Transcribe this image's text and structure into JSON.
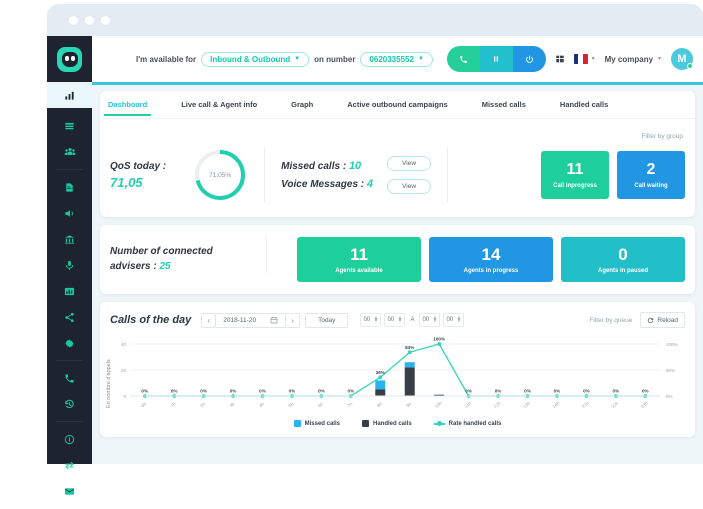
{
  "window": {
    "dots": 3
  },
  "header": {
    "available_prefix": "I'm available for",
    "availability": "Inbound & Outbound",
    "on_number_label": "on number",
    "number": "0620335552",
    "company": "My company",
    "avatar_initial": "M",
    "buttons": [
      {
        "name": "call-button",
        "icon": "phone-icon",
        "color": "#25cf9a"
      },
      {
        "name": "pause-button",
        "icon": "pause-icon",
        "color": "#24bfcc"
      },
      {
        "name": "power-button",
        "icon": "power-icon",
        "color": "#2196e3"
      }
    ],
    "apps_icon": "grid-icon",
    "language": "fr"
  },
  "sidebar": {
    "items": [
      {
        "name": "sidebar-item-dashboard",
        "icon": "bar-chart-icon",
        "active": true
      },
      {
        "name": "sidebar-item-tables",
        "icon": "table-icon",
        "active": false
      },
      {
        "name": "sidebar-item-groups",
        "icon": "users-icon",
        "active": false
      },
      {
        "name": "sidebar-item-documents",
        "icon": "document-icon",
        "active": false
      },
      {
        "name": "sidebar-item-announcements",
        "icon": "megaphone-icon",
        "active": false
      },
      {
        "name": "sidebar-item-company",
        "icon": "bank-icon",
        "active": false
      },
      {
        "name": "sidebar-item-recordings",
        "icon": "microphone-icon",
        "active": false
      },
      {
        "name": "sidebar-item-statistics",
        "icon": "chart-bars-icon",
        "active": false
      },
      {
        "name": "sidebar-item-routing",
        "icon": "share-nodes-icon",
        "active": false
      },
      {
        "name": "sidebar-item-settings",
        "icon": "gear-icon",
        "active": false
      },
      {
        "name": "sidebar-item-calls",
        "icon": "phone-icon",
        "active": false
      },
      {
        "name": "sidebar-item-history",
        "icon": "history-icon",
        "active": false
      },
      {
        "name": "sidebar-item-info",
        "icon": "info-icon",
        "active": false
      },
      {
        "name": "sidebar-item-transfer",
        "icon": "transfer-icon",
        "active": false
      },
      {
        "name": "sidebar-item-messages",
        "icon": "message-icon",
        "active": false
      }
    ]
  },
  "tabs": [
    {
      "label": "Dashboard",
      "active": true
    },
    {
      "label": "Live call & Agent info",
      "active": false
    },
    {
      "label": "Graph",
      "active": false
    },
    {
      "label": "Active outbound campaigns",
      "active": false
    },
    {
      "label": "Missed calls",
      "active": false
    },
    {
      "label": "Handled calls",
      "active": false
    }
  ],
  "dashboard": {
    "filter_by_group": "Filter by group",
    "qos_label": "QoS today :",
    "qos_value": "71,05",
    "qos_donut_text": "71,05%",
    "qos_percent": 71.05,
    "missed_calls_label": "Missed calls :",
    "missed_calls_value": "10",
    "voice_messages_label": "Voice Messages :",
    "voice_messages_value": "4",
    "view_button": "View",
    "stat_cards": [
      {
        "value": "11",
        "label": "Call inprogress",
        "color": "#1ecf9c"
      },
      {
        "value": "2",
        "label": "Call waiting",
        "color": "#2196e3"
      }
    ],
    "advisers_label_line1": "Number of connected",
    "advisers_label_line2": "advisers :",
    "advisers_value": "25",
    "adviser_cards": [
      {
        "value": "11",
        "label": "Agents available",
        "color": "#1ecf9c"
      },
      {
        "value": "14",
        "label": "Agents in progress",
        "color": "#2196e3"
      },
      {
        "value": "0",
        "label": "Agents in paused",
        "color": "#22bfc9"
      }
    ]
  },
  "calls_panel": {
    "title": "Calls of the day",
    "prev_label": "‹",
    "next_label": "›",
    "date": "2018-11-20",
    "calendar_icon": "calendar-icon",
    "today_label": "Today",
    "time_from_hh": "00",
    "time_from_mm": "00",
    "time_separator": "A",
    "time_to_hh": "00",
    "time_to_mm": "00",
    "filter_by_queue": "Filter by queue",
    "reload_label": "Reload",
    "reload_icon": "refresh-icon"
  },
  "chart_data": {
    "type": "bar",
    "title": "Calls of the day",
    "xlabel": "",
    "ylabel": "En nombre d'appels",
    "categories": [
      "0h",
      "1h",
      "2h",
      "3h",
      "4h",
      "5h",
      "6h",
      "7h",
      "8h",
      "9h",
      "10h",
      "11h",
      "12h",
      "13h",
      "14h",
      "21h",
      "22h",
      "23h"
    ],
    "ylim": [
      0,
      40
    ],
    "yticks": [
      0,
      20,
      40
    ],
    "y2lim": [
      0,
      100
    ],
    "y2ticks": [
      "0%",
      "50%",
      "100%"
    ],
    "grid": true,
    "legend_position": "bottom",
    "series": [
      {
        "name": "Missed calls",
        "color": "#2bb3f0",
        "type": "bar",
        "values": [
          0,
          0,
          0,
          0,
          0,
          0,
          0,
          0,
          7,
          4,
          0,
          0,
          0,
          0,
          0,
          0,
          0,
          0
        ]
      },
      {
        "name": "Handled calls",
        "color": "#3a3f46",
        "type": "bar",
        "values": [
          0,
          0,
          0,
          0,
          0,
          0,
          0,
          0,
          5,
          22,
          1,
          0,
          0,
          0,
          0,
          0,
          0,
          0
        ]
      },
      {
        "name": "Rate handled calls",
        "color": "#2fd4bb",
        "type": "line",
        "values": [
          0,
          0,
          0,
          0,
          0,
          0,
          0,
          0,
          36,
          84,
          100,
          0,
          0,
          0,
          0,
          0,
          0,
          0
        ],
        "labels": [
          "0%",
          "0%",
          "0%",
          "0%",
          "0%",
          "0%",
          "0%",
          "0%",
          "36%",
          "84%",
          "100%",
          "0%",
          "0%",
          "0%",
          "0%",
          "0%",
          "0%",
          "0%"
        ]
      }
    ]
  }
}
